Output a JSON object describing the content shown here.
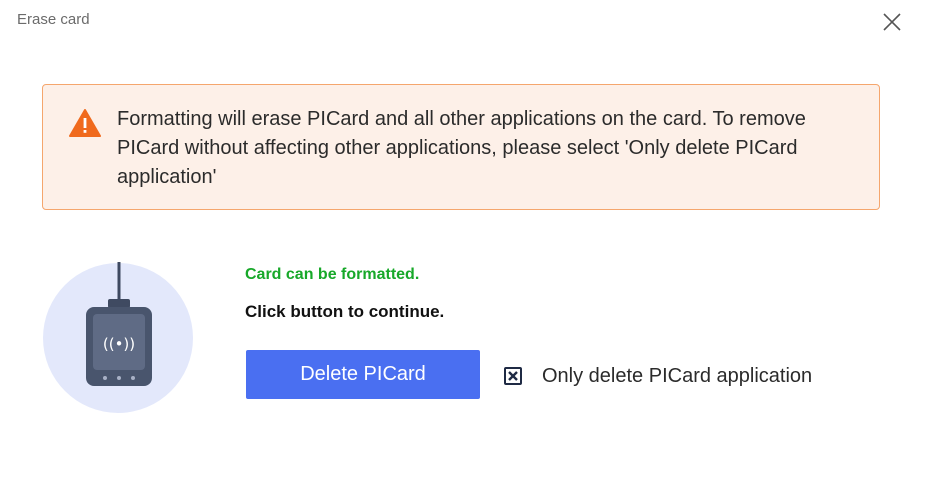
{
  "dialog": {
    "title": "Erase card",
    "close_icon": "close-icon"
  },
  "warning": {
    "icon": "warning-triangle-icon",
    "text": "Formatting will erase PICard and all other applications on the card. To remove PICard without affecting other applications, please select 'Only delete PICard application'",
    "border_color": "#f5a66d",
    "background_color": "#fdf0e8",
    "icon_color": "#f06a1d"
  },
  "status": {
    "message": "Card can be formatted.",
    "instruction": "Click button to continue.",
    "color": "#17a829"
  },
  "illustration": {
    "icon": "card-reader-icon",
    "nfc_icon": "nfc-signal-icon"
  },
  "actions": {
    "delete_button_label": "Delete PICard",
    "button_color": "#4a6ff1",
    "only_delete_checkbox": {
      "label": "Only delete PICard application",
      "checked": true
    }
  }
}
